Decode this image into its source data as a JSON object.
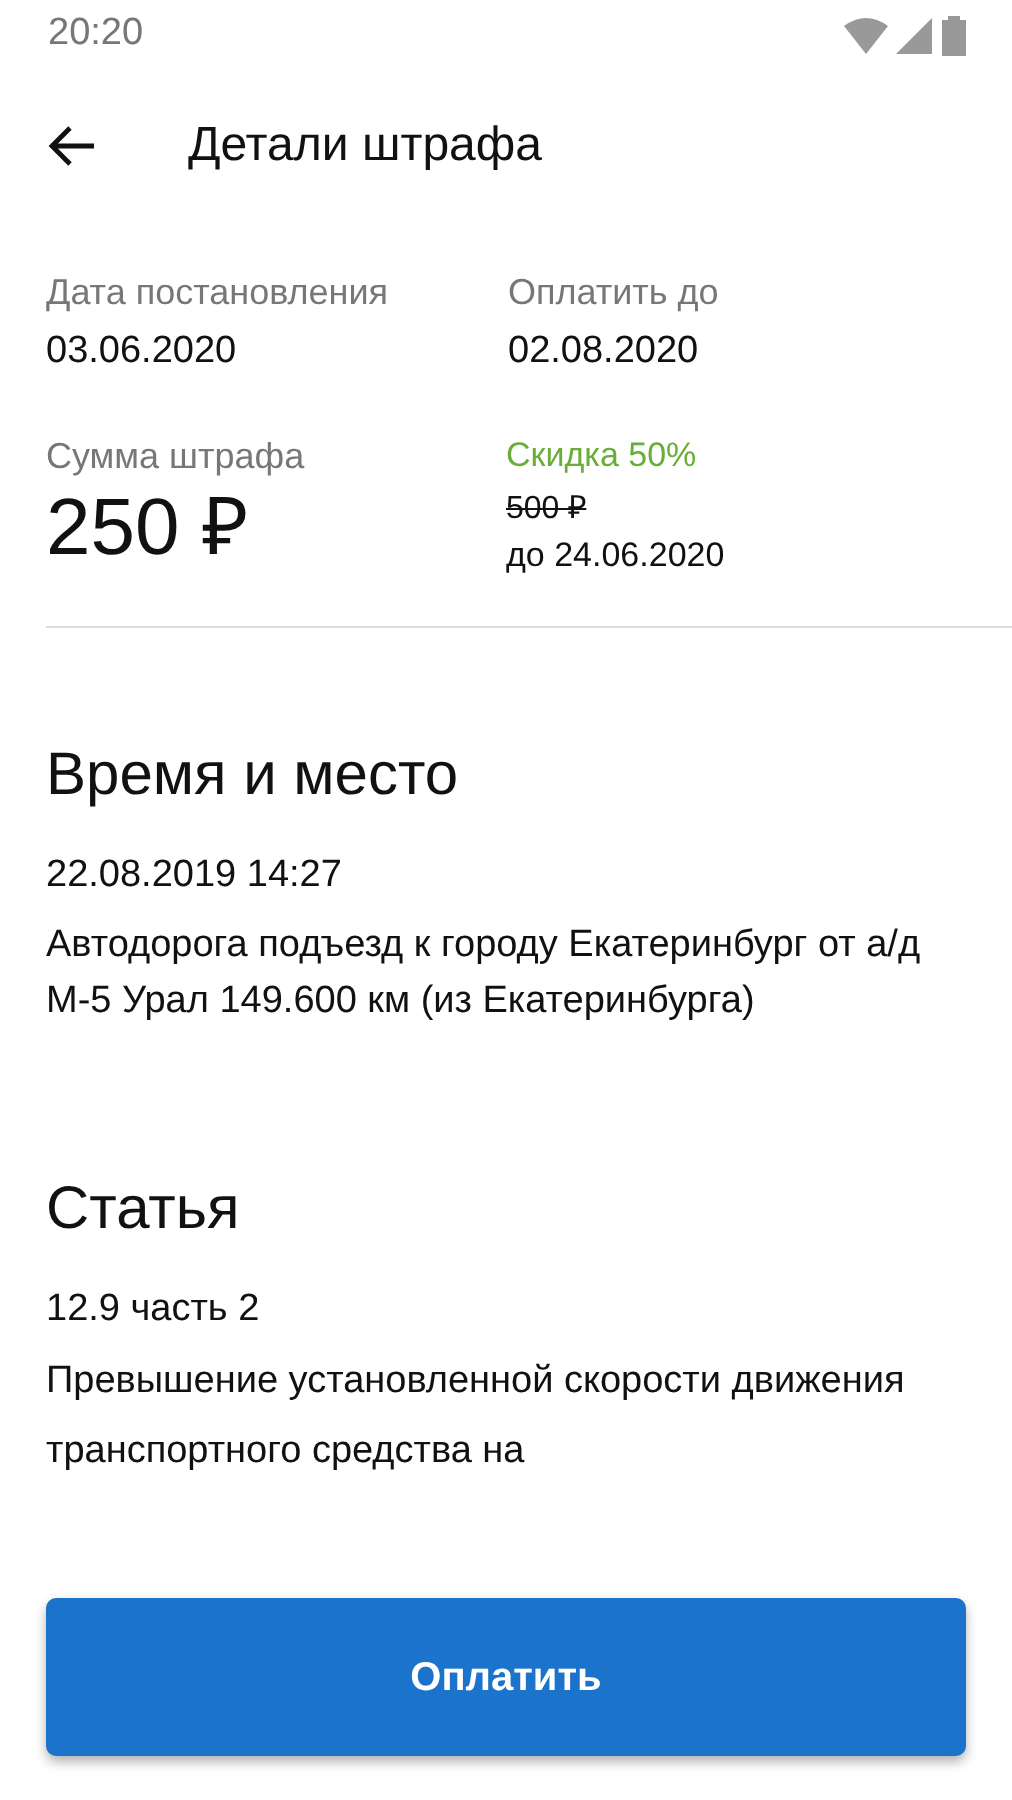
{
  "status_bar": {
    "time": "20:20"
  },
  "header": {
    "title": "Детали штрафа"
  },
  "dates": [
    {
      "label": "Дата постановления",
      "value": "03.06.2020"
    },
    {
      "label": "Оплатить до",
      "value": "02.08.2020"
    }
  ],
  "amount": {
    "label": "Сумма штрафа",
    "value": "250 ₽"
  },
  "discount": {
    "label": "Скидка 50%",
    "old_amount": "500 ₽",
    "until": "до 24.06.2020"
  },
  "time_place": {
    "title": "Время и место",
    "datetime": "22.08.2019 14:27",
    "address": "Автодорога подъезд к городу Екатеринбург от а/д М-5 Урал 149.600 км (из Екатеринбурга)"
  },
  "article": {
    "title": "Статья",
    "number": "12.9 часть 2",
    "description": "Превышение установленной скорости движения транспортного средства на"
  },
  "pay_button": {
    "label": "Оплатить"
  }
}
